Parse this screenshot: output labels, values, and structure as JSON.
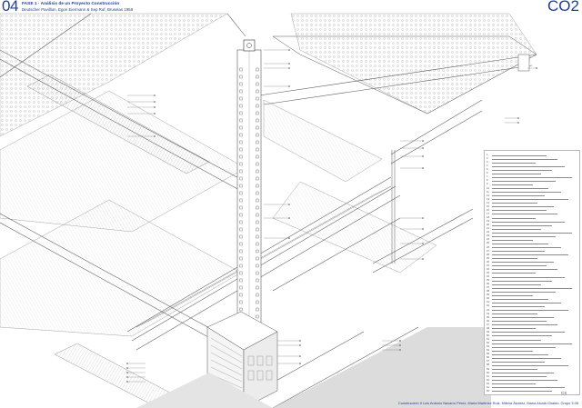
{
  "header": {
    "sheet_number": "04",
    "title": "FASE 1 · Análisis de un Proyecto Construcción",
    "subtitle": "Deutscher Pavillion, Egon Eiermann & Sep Ruf, Bruselas 1958",
    "code": "CO2"
  },
  "credits": "Construcción II Luis Antonio Navarro Pérez, María Martínez Ruiz, Milena Álvarez, María Alcalá Giraldo, Grupo 3.08",
  "logo_text": "CS",
  "colors": {
    "accent": "#1e3e96",
    "line": "#6b6b6b",
    "light_fill": "#e4e4e4",
    "ground_fill": "#dcdcdc"
  },
  "legend_items": [
    "1",
    "2",
    "3",
    "4",
    "5",
    "6",
    "7",
    "8",
    "9",
    "10",
    "11",
    "12",
    "13",
    "14",
    "15",
    "16",
    "17",
    "18",
    "19",
    "20",
    "21",
    "22",
    "23",
    "24",
    "25",
    "26",
    "27",
    "28",
    "29",
    "30",
    "31",
    "32",
    "33",
    "34",
    "35",
    "36",
    "37",
    "38",
    "39",
    "40",
    "41",
    "42",
    "43",
    "44",
    "45",
    "46",
    "47",
    "48",
    "49",
    "50",
    "51",
    "52",
    "53",
    "54",
    "55",
    "56",
    "57",
    "58",
    "59",
    "60",
    "61",
    "62",
    "63",
    "64",
    "65"
  ]
}
